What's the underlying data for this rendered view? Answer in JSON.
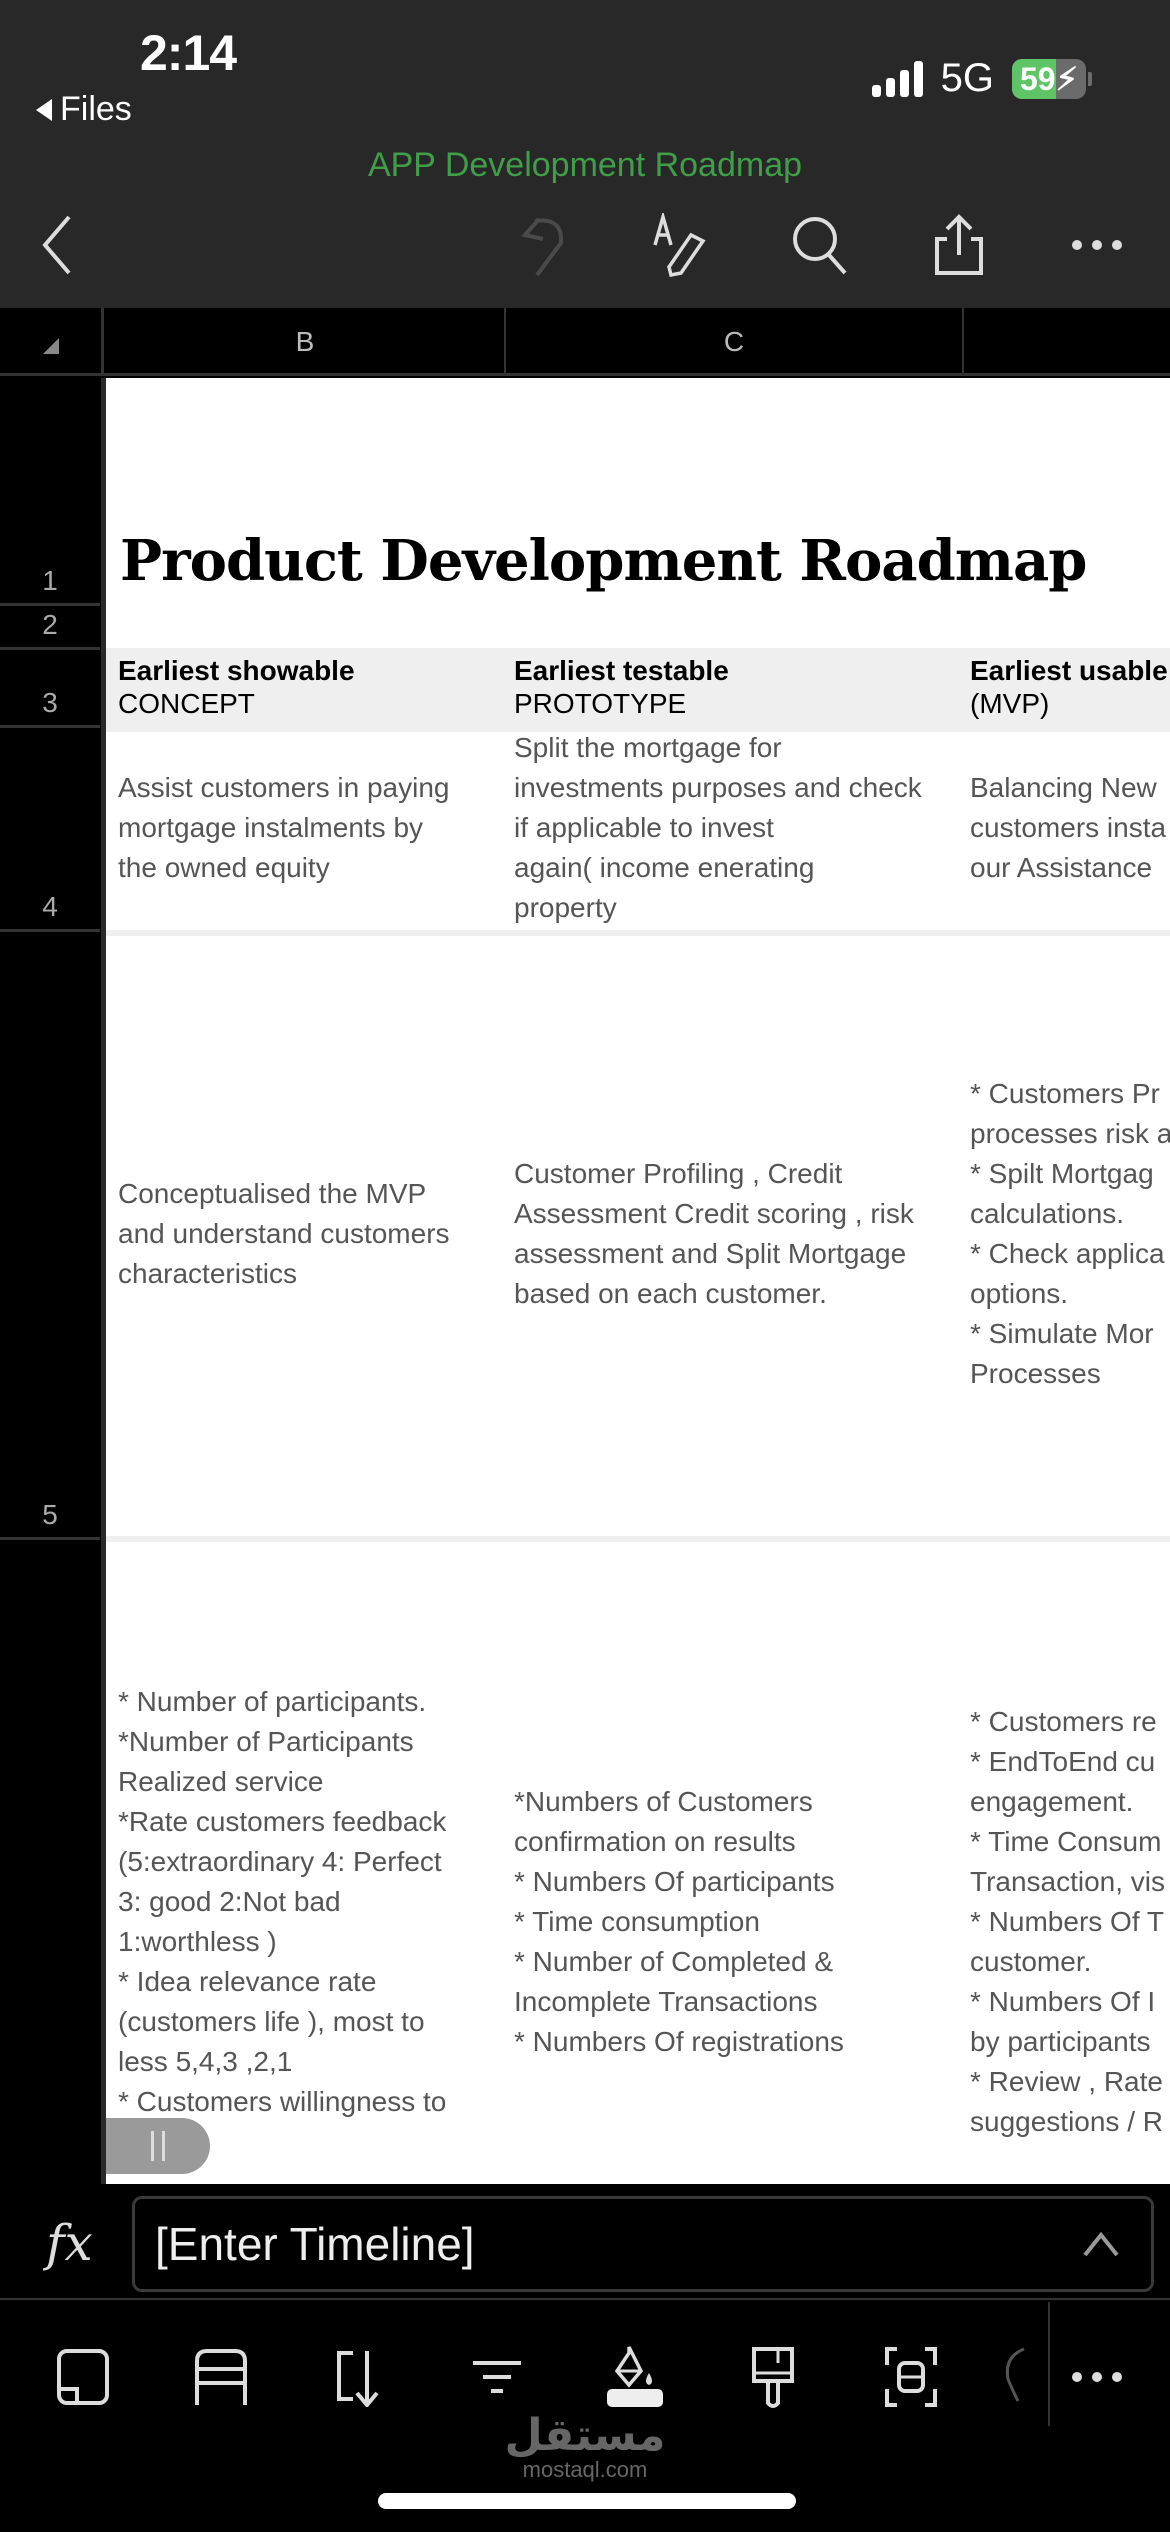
{
  "status_bar": {
    "time": "2:14",
    "back_app": "Files",
    "network": "5G",
    "battery_percent": 59,
    "battery_label": "59",
    "battery_charging": true,
    "battery_color": "#5fc466"
  },
  "app": {
    "document_title": "APP Development Roadmap",
    "title_color": "#3f9e47",
    "toolbar": [
      {
        "icon": "chevron-left-icon",
        "label": "Back"
      },
      {
        "icon": "undo-icon",
        "label": "Undo",
        "enabled": false
      },
      {
        "icon": "text-edit-icon",
        "label": "Edit"
      },
      {
        "icon": "search-icon",
        "label": "Search"
      },
      {
        "icon": "share-icon",
        "label": "Share"
      },
      {
        "icon": "more-icon",
        "label": "More"
      }
    ]
  },
  "sheet": {
    "columns": [
      "B",
      "C",
      ""
    ],
    "rows": [
      "1",
      "2",
      "3",
      "4",
      "5",
      ""
    ],
    "title": "Product Development Roadmap",
    "headers": [
      {
        "bold": "Earliest showable",
        "sub": "CONCEPT"
      },
      {
        "bold": "Earliest testable",
        "sub": "PROTOTYPE"
      },
      {
        "bold": "Earliest usable",
        "sub": "(MVP)"
      }
    ],
    "row4": [
      "Assist customers in paying\nmortgage instalments by\nthe owned equity",
      "Split the mortgage for\ninvestments purposes and check\nif applicable to  invest\nagain( income enerating\nproperty",
      "Balancing New\ncustomers insta\nour Assistance"
    ],
    "row5": [
      "Conceptualised the MVP\nand understand customers\ncharacteristics",
      "Customer Profiling , Credit\nAssessment Credit scoring , risk\nassessment and Split Mortgage\nbased on each customer.",
      "* Customers Pr\nprocesses risk a\n* Spilt Mortgag\ncalculations.\n* Check applica\noptions.\n* Simulate Mor\nProcesses"
    ],
    "row6": [
      "* Number of participants.\n*Number of Participants\nRealized service\n*Rate customers feedback\n(5:extraordinary 4: Perfect\n3: good 2:Not bad\n1:worthless )\n* Idea relevance rate\n(customers life ), most to\nless 5,4,3 ,2,1\n* Customers willingness to",
      "*Numbers of Customers\nconfirmation on results\n* Numbers Of participants\n* Time consumption\n* Number of Completed &\nIncomplete Transactions\n* Numbers Of registrations",
      "* Customers re\n* EndToEnd cu\nengagement.\n* Time Consum\nTransaction, vis\n* Numbers Of T\ncustomer.\n* Numbers Of I\nby participants\n* Review , Rate\nsuggestions / R"
    ]
  },
  "formula_bar": {
    "fx_label": "fx",
    "value": "[Enter Timeline]"
  },
  "bottom_toolbar": [
    {
      "icon": "sheet-view-icon"
    },
    {
      "icon": "freeze-rows-icon"
    },
    {
      "icon": "sort-icon"
    },
    {
      "icon": "filter-icon"
    },
    {
      "icon": "fill-color-icon"
    },
    {
      "icon": "format-painter-icon"
    },
    {
      "icon": "select-range-icon"
    },
    {
      "icon": "ideas-icon"
    },
    {
      "icon": "more-icon"
    }
  ],
  "watermark": {
    "arabic": "مستقل",
    "latin": "mostaql.com"
  }
}
